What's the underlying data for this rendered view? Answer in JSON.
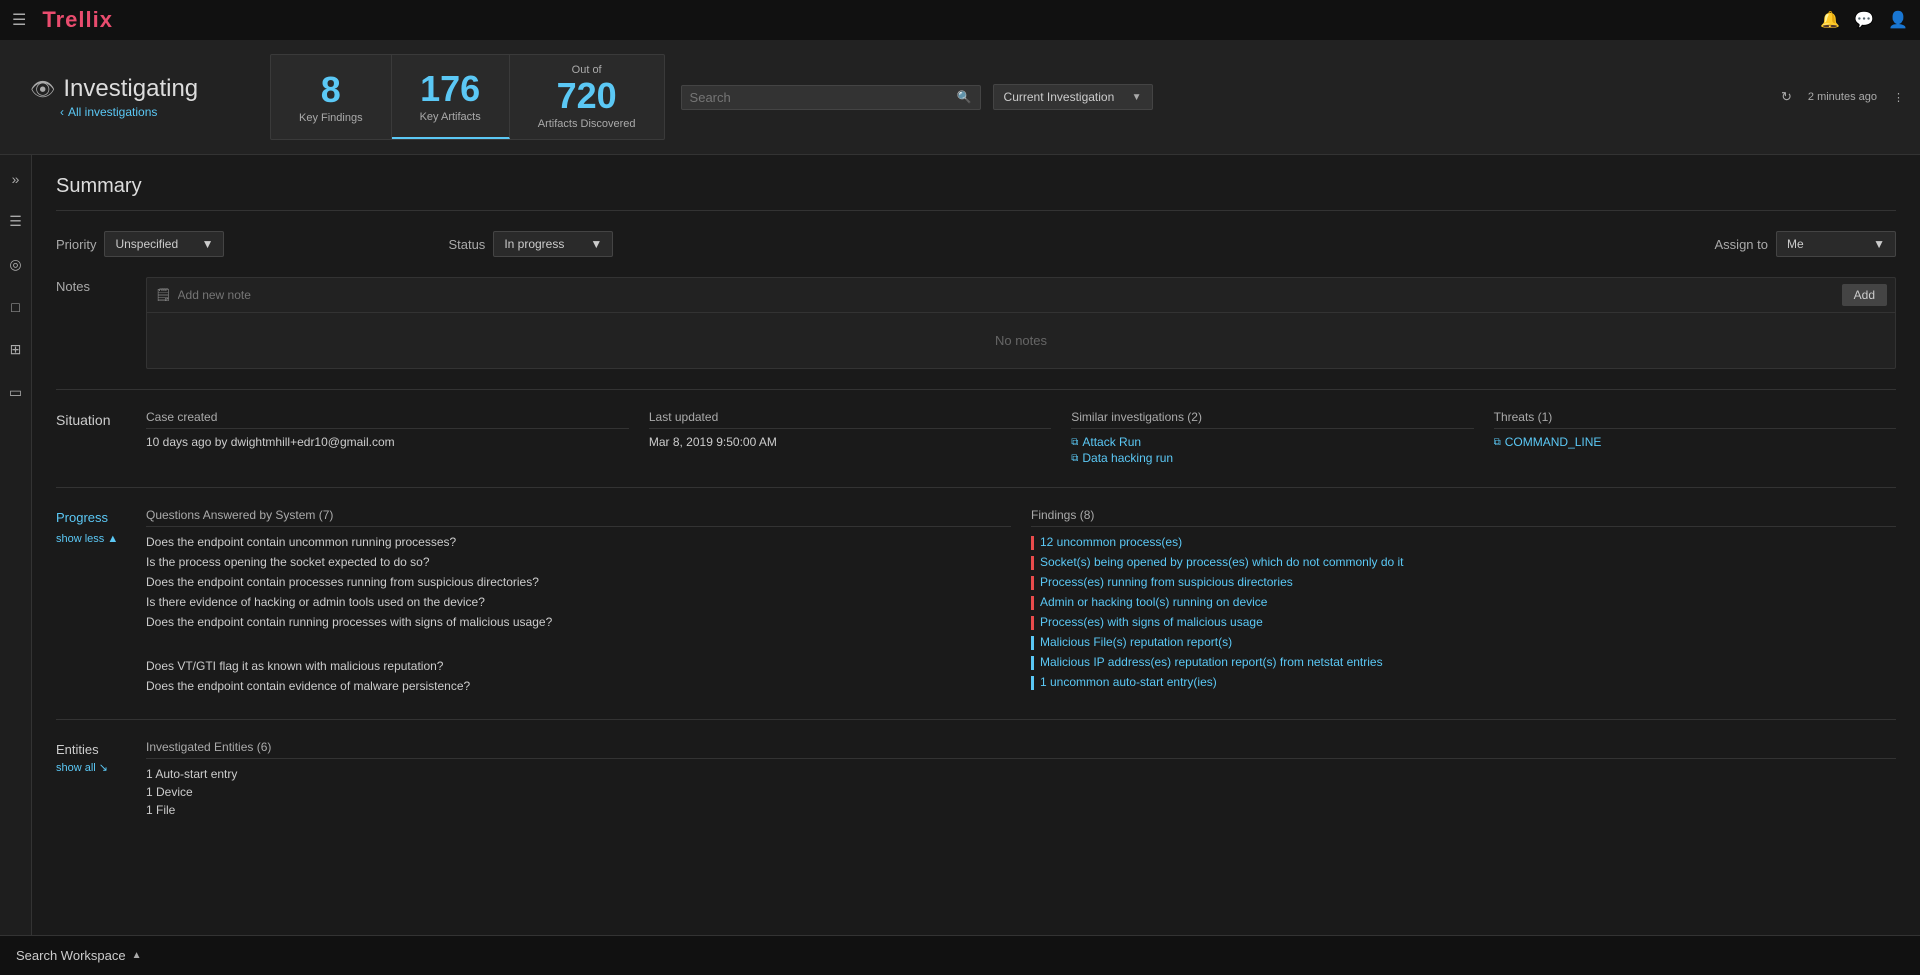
{
  "topbar": {
    "logo": "Trellix",
    "icons": {
      "hamburger": "☰",
      "bell": "🔔",
      "chat": "💬",
      "user": "👤"
    }
  },
  "header": {
    "investigating_label": "Investigating",
    "all_investigations_link": "All investigations",
    "stats": {
      "key_findings_number": "8",
      "key_findings_label": "Key Findings",
      "key_artifacts_number": "176",
      "key_artifacts_label": "Key Artifacts",
      "out_of_label": "Out of",
      "artifacts_number": "720",
      "artifacts_label": "Artifacts Discovered"
    },
    "search_placeholder": "Search",
    "filter_dropdown_label": "Current Investigation",
    "refresh_label": "2 minutes ago",
    "more_icon": "⋮"
  },
  "sidebar": {
    "icons": [
      "»",
      "☰",
      "◎",
      "□",
      "⊞",
      "▭"
    ]
  },
  "page": {
    "title": "Summary",
    "priority_label": "Priority",
    "priority_value": "Unspecified",
    "status_label": "Status",
    "status_value": "In progress",
    "assign_label": "Assign to",
    "assign_value": "Me",
    "notes_label": "Notes",
    "notes_placeholder": "Add new note",
    "notes_add_btn": "Add",
    "notes_empty": "No notes"
  },
  "situation": {
    "section_label": "Situation",
    "columns": [
      {
        "header": "Case created",
        "value": "10 days ago by dwightmhill+edr10@gmail.com"
      },
      {
        "header": "Last updated",
        "value": "Mar 8, 2019 9:50:00 AM"
      },
      {
        "header": "Similar investigations (2)",
        "links": [
          "Attack Run",
          "Data hacking run"
        ]
      },
      {
        "header": "Threats (1)",
        "links": [
          "COMMAND_LINE"
        ]
      }
    ]
  },
  "progress": {
    "section_label": "Progress",
    "show_less": "show less ▲",
    "questions_header": "Questions Answered by System (7)",
    "findings_header": "Findings (8)",
    "questions": [
      "Does the endpoint contain uncommon running processes?",
      "Is the process opening the socket expected to do so?",
      "Does the endpoint contain processes running from suspicious directories?",
      "Is there evidence of hacking or admin tools used on the device?",
      "Does the endpoint contain running processes with signs of malicious usage?",
      "",
      "Does VT/GTI flag it as known with malicious reputation?",
      "Does the endpoint contain evidence of malware persistence?"
    ],
    "findings": [
      {
        "text": "12 uncommon process(es)",
        "color": "red"
      },
      {
        "text": "Socket(s) being opened by process(es) which do not commonly do it",
        "color": "red"
      },
      {
        "text": "Process(es) running from suspicious directories",
        "color": "red"
      },
      {
        "text": "Admin or hacking tool(s) running on device",
        "color": "red"
      },
      {
        "text": "Process(es) with signs of malicious usage",
        "color": "red"
      },
      {
        "text": "Malicious File(s) reputation report(s)",
        "color": "blue"
      },
      {
        "text": "Malicious IP address(es) reputation report(s) from netstat entries",
        "color": "blue"
      },
      {
        "text": "1 uncommon auto-start entry(ies)",
        "color": "blue"
      }
    ]
  },
  "entities": {
    "section_label": "Entities",
    "show_all": "show all ↘",
    "investigated_header": "Investigated Entities (6)",
    "items": [
      "1 Auto-start entry",
      "1 Device",
      "1 File"
    ]
  },
  "bottom": {
    "search_workspace": "Search Workspace",
    "chevron": "▲"
  }
}
